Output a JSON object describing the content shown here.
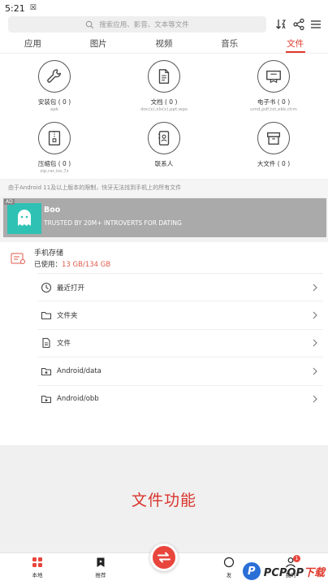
{
  "status_bar": {
    "time": "5:21",
    "extra_glyph": "☒"
  },
  "search": {
    "placeholder": "搜索应用、影音、文本等文件"
  },
  "tabs": [
    {
      "label": "应用",
      "active": false
    },
    {
      "label": "图片",
      "active": false
    },
    {
      "label": "视频",
      "active": false
    },
    {
      "label": "音乐",
      "active": false
    },
    {
      "label": "文件",
      "active": true
    }
  ],
  "categories": [
    {
      "label": "安装包 ( 0 )",
      "sub": "apk",
      "icon": "wrench-icon"
    },
    {
      "label": "文档 ( 0 )",
      "sub": "doc(x),xls(x),ppt,wps",
      "icon": "document-icon"
    },
    {
      "label": "电子书 ( 0 )",
      "sub": "umd,pdf,txt,ebk,chm",
      "icon": "ebook-icon"
    },
    {
      "label": "压缩包 ( 0 )",
      "sub": "zip,rar,iso,7z",
      "icon": "archive-icon"
    },
    {
      "label": "联系人",
      "sub": "",
      "icon": "contact-icon"
    },
    {
      "label": "大文件 ( 0 )",
      "sub": "",
      "icon": "large-file-icon"
    }
  ],
  "notice": "由于Android 11及以上版本的限制，快牙无法找到手机上的所有文件",
  "ad": {
    "badge": "AD",
    "title": "Boo",
    "description": "TRUSTED BY 20M+ INTROVERTS FOR DATING",
    "logo_color": "#2fc2b4"
  },
  "storage": {
    "title": "手机存储",
    "used_label": "已使用：",
    "used_value": "13 GB/134 GB",
    "rows": [
      {
        "label": "最近打开",
        "icon": "clock-icon"
      },
      {
        "label": "文件夹",
        "icon": "folder-icon"
      },
      {
        "label": "文件",
        "icon": "file-icon"
      },
      {
        "label": "Android/data",
        "icon": "folder-star-icon"
      },
      {
        "label": "Android/obb",
        "icon": "folder-star-icon"
      }
    ]
  },
  "banner": {
    "text": "文件功能"
  },
  "bottom_nav": {
    "items": [
      {
        "label": "本地",
        "icon": "grid-icon"
      },
      {
        "label": "推荐",
        "icon": "bookmark-icon"
      },
      {
        "label": "发",
        "icon": "send-icon"
      },
      {
        "label": "我的",
        "icon": "user-icon"
      }
    ],
    "badge_count": "1",
    "fab_icon": "transfer-icon"
  },
  "watermark": {
    "main": "PCPOP",
    "suffix": "下载",
    "mark": "P"
  },
  "colors": {
    "accent": "#e03a2e",
    "used_value": "#e05a4a",
    "banner_text": "#d9342b"
  }
}
